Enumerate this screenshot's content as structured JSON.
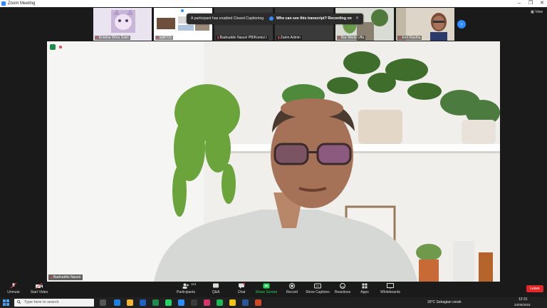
{
  "window": {
    "title": "Zoom Meeting",
    "controls": [
      "–",
      "❐",
      "✕"
    ]
  },
  "gallery": {
    "participants": [
      {
        "name": "Kristina Wina Sakti",
        "muted": true
      },
      {
        "name": "SAPTO",
        "muted": true
      },
      {
        "name": "Badruddin Nasori PB/Komisi I",
        "muted": true
      },
      {
        "name": "Zarim Admin",
        "muted": true
      },
      {
        "name": "Nur Merie Ulfa",
        "muted": true
      },
      {
        "name": "Jerri Rasiha",
        "muted": true
      }
    ],
    "view_label": "View",
    "next_label": "›"
  },
  "banner": {
    "message": "A participant has enabled Closed Captioning",
    "question": "Who can see this transcript? Recording on",
    "close": "✕"
  },
  "main_video": {
    "speaker_name": "Badruddin Nasori"
  },
  "toolbar": {
    "left": [
      {
        "label": "Unmute",
        "icon": "mic-muted-icon"
      },
      {
        "label": "Start Video",
        "icon": "video-off-icon"
      }
    ],
    "center": [
      {
        "label": "Participants",
        "icon": "participants-icon",
        "badge": "113"
      },
      {
        "label": "Q&A",
        "icon": "qa-icon"
      },
      {
        "label": "Chat",
        "icon": "chat-icon"
      },
      {
        "label": "Share Screen",
        "icon": "share-screen-icon"
      },
      {
        "label": "Record",
        "icon": "record-icon"
      },
      {
        "label": "Show Captions",
        "icon": "captions-icon"
      },
      {
        "label": "Reactions",
        "icon": "reactions-icon"
      },
      {
        "label": "Apps",
        "icon": "apps-icon"
      },
      {
        "label": "Whiteboards",
        "icon": "whiteboard-icon"
      }
    ],
    "leave_label": "Leave",
    "colors": {
      "share": "#23d959",
      "leave": "#e02828",
      "accent": "#2d8cff"
    }
  },
  "taskbar": {
    "search_placeholder": "Type here to search",
    "weather": "33°C  Sebagian cerah",
    "time": "12:31",
    "date": "23/05/2023"
  }
}
